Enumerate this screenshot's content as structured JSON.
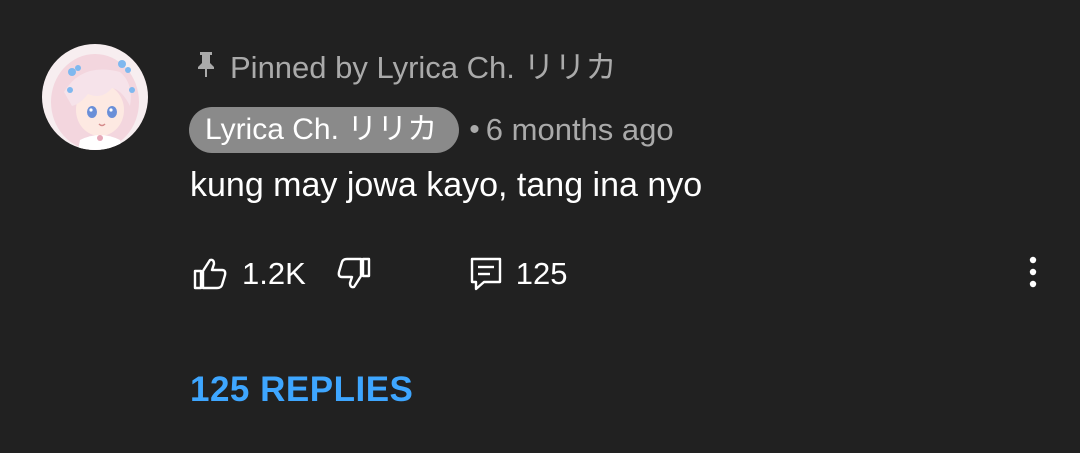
{
  "comment": {
    "avatar_icon": "user-avatar-anime-girl",
    "pinned_icon": "pin-icon",
    "pinned_text": "Pinned by Lyrica Ch. リリカ",
    "author": "Lyrica Ch. リリカ",
    "separator": "•",
    "timestamp": "6 months ago",
    "text": "kung may jowa kayo, tang ina nyo",
    "like_icon": "thumbs-up-icon",
    "like_count": "1.2K",
    "dislike_icon": "thumbs-down-icon",
    "reply_icon": "reply-comment-icon",
    "reply_count": "125",
    "more_icon": "more-vertical-icon",
    "replies_label": "125 REPLIES"
  },
  "colors": {
    "background": "#212121",
    "secondary_text": "#aaaaaa",
    "author_chip": "#8a8a8a",
    "link": "#3ea6ff"
  }
}
